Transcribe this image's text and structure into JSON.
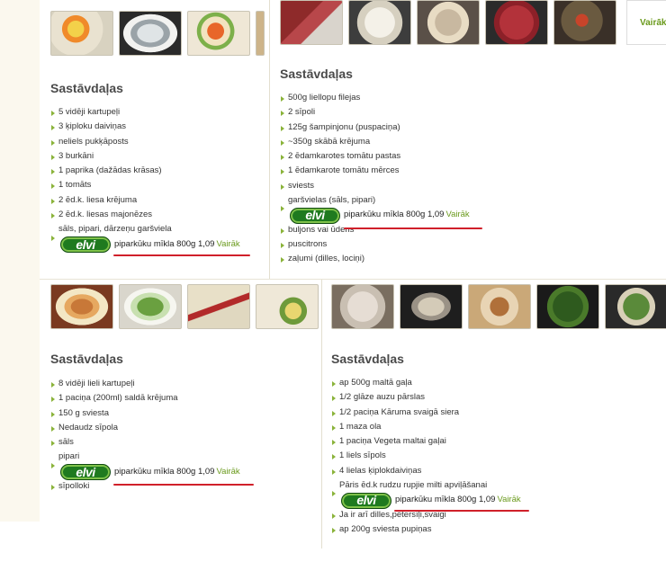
{
  "panels": {
    "p1": {
      "heading": "Sastāvdaļas",
      "items": [
        {
          "t": "5 vidēji kartupeļi",
          "b": true
        },
        {
          "t": "3 ķiploku daiviņas",
          "b": true
        },
        {
          "t": "neliels pukķāposts",
          "b": true
        },
        {
          "t": "3 burkāni",
          "b": true
        },
        {
          "t": "1 paprika (dažādas krāsas)",
          "b": true
        },
        {
          "t": "1 tomāts",
          "b": true
        },
        {
          "t": "2 ēd.k. liesa krējuma",
          "b": true
        },
        {
          "t": "2 ēd.k. liesas majonēzes",
          "b": true
        },
        {
          "t": "sāls, pipari, dārzeņu garšviela",
          "b": false
        }
      ],
      "ad": {
        "text": "piparkūku mīkla 800g 1,09",
        "more": "Vairāk"
      },
      "after": []
    },
    "p2": {
      "heading": "Sastāvdaļas",
      "items": [
        {
          "t": "500g liellopu filejas",
          "b": true
        },
        {
          "t": "2 sīpoli",
          "b": true
        },
        {
          "t": "125g šampinjonu (puspaciņa)",
          "b": true
        },
        {
          "t": "~350g skābā krējuma",
          "b": true
        },
        {
          "t": "2 ēdamkarotes tomātu pastas",
          "b": true
        },
        {
          "t": "1 ēdamkarote tomātu mērces",
          "b": true
        },
        {
          "t": "sviests",
          "b": true
        },
        {
          "t": "garšvielas (sāls, pipari)",
          "b": false
        }
      ],
      "ad": {
        "text": "piparkūku mīkla 800g 1,09",
        "more": "Vairāk"
      },
      "after": [
        {
          "t": "buljons vai ūdens",
          "b": true
        },
        {
          "t": "puscitrons",
          "b": true
        },
        {
          "t": "zaļumi (dilles, lociņi)",
          "b": true
        }
      ]
    },
    "p3": {
      "heading": "Sastāvdaļas",
      "items": [
        {
          "t": "8 vidēji lieli kartupeļi",
          "b": true
        },
        {
          "t": "1 paciņa (200ml) saldā krējuma",
          "b": true
        },
        {
          "t": "150 g sviesta",
          "b": true
        },
        {
          "t": "Nedaudz sīpola",
          "b": true
        },
        {
          "t": "sāls",
          "b": true
        },
        {
          "t": "pipari",
          "b": false
        }
      ],
      "ad": {
        "text": "piparkūku mīkla 800g 1,09",
        "more": "Vairāk"
      },
      "after": [
        {
          "t": "sīpolloki",
          "b": true
        }
      ]
    },
    "p4": {
      "heading": "Sastāvdaļas",
      "items": [
        {
          "t": "ap 500g maltā gaļa",
          "b": true
        },
        {
          "t": "1/2 glāze auzu pārslas",
          "b": true
        },
        {
          "t": "1/2 paciņa Kāruma svaigā siera",
          "b": true
        },
        {
          "t": "1 maza ola",
          "b": true
        },
        {
          "t": "1 paciņa Vegeta maltai gaļai",
          "b": true
        },
        {
          "t": "1 liels sīpols",
          "b": true
        },
        {
          "t": "4 lielas ķiplokdaiviņas",
          "b": true
        },
        {
          "t": "Pāris ēd.k rudzu rupjie milti apviļāšanai",
          "b": false
        }
      ],
      "ad": {
        "text": "piparkūku mīkla 800g 1,09",
        "more": "Vairāk"
      },
      "after": [
        {
          "t": "Ja ir arī dilles,pētersīļi,svaigi",
          "b": true
        },
        {
          "t": "ap 200g sviesta pupiņas",
          "b": true
        }
      ]
    }
  },
  "side_more": "Vairāk",
  "ad_logo": "elvi",
  "colors": {
    "accent": "#8ab33a",
    "link": "#6a9a1c",
    "underline": "#d0202a",
    "logo": "#1f7a1f"
  }
}
